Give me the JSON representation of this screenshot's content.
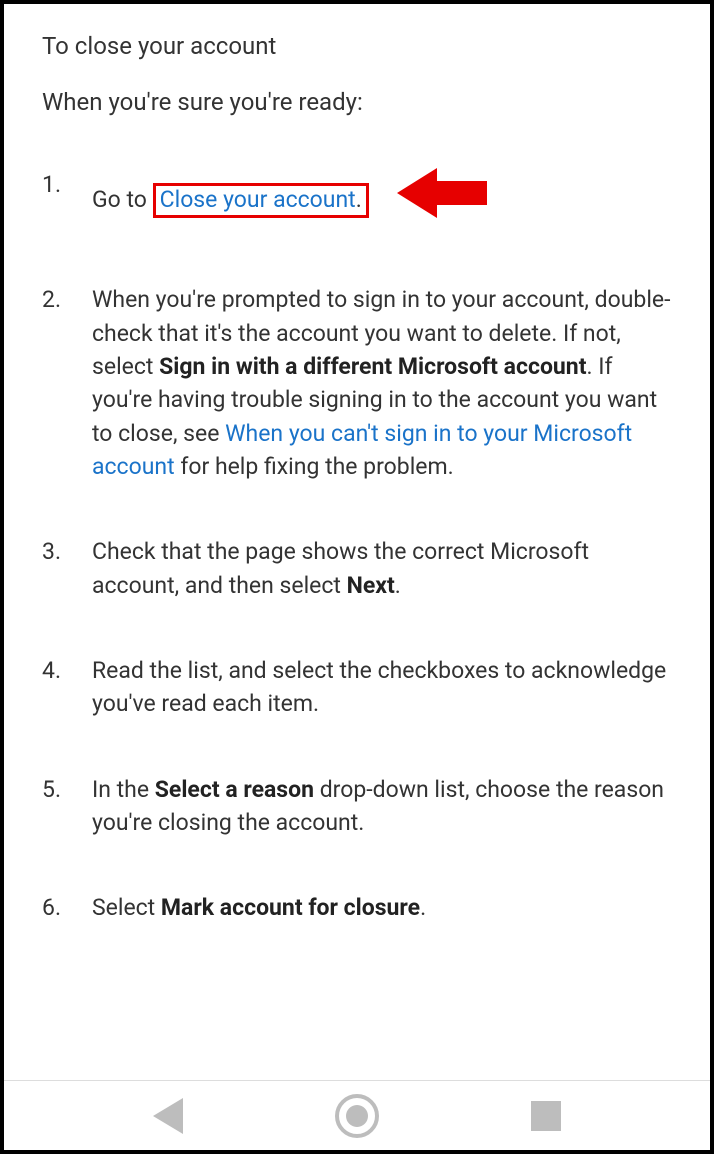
{
  "heading": "To close your account",
  "intro": "When you're sure you're ready:",
  "steps": {
    "s1": {
      "prefix": "Go to ",
      "link": "Close your account",
      "suffix": "."
    },
    "s2": {
      "prefix": "When you're prompted to sign in to your account, double-check that it's the account you want to delete. If not, select ",
      "bold1": "Sign in with a different Microsoft account",
      "mid": ". If you're having trouble signing in to the account you want to close, see ",
      "link": "When you can't sign in to your Microsoft account",
      "suffix": " for help fixing the problem."
    },
    "s3": {
      "prefix": "Check that the page shows the correct Microsoft account, and then select ",
      "bold": "Next",
      "suffix": "."
    },
    "s4": {
      "text": "Read the list, and select the checkboxes to acknowledge you've read each item."
    },
    "s5": {
      "prefix": "In the ",
      "bold": "Select a reason",
      "suffix": " drop-down list, choose the reason you're closing the account."
    },
    "s6": {
      "prefix": "Select ",
      "bold": "Mark account for closure",
      "suffix": "."
    }
  },
  "colors": {
    "link": "#1a73c9",
    "highlight": "#e60000",
    "arrow": "#e60000",
    "nav": "#bdbdbd"
  }
}
